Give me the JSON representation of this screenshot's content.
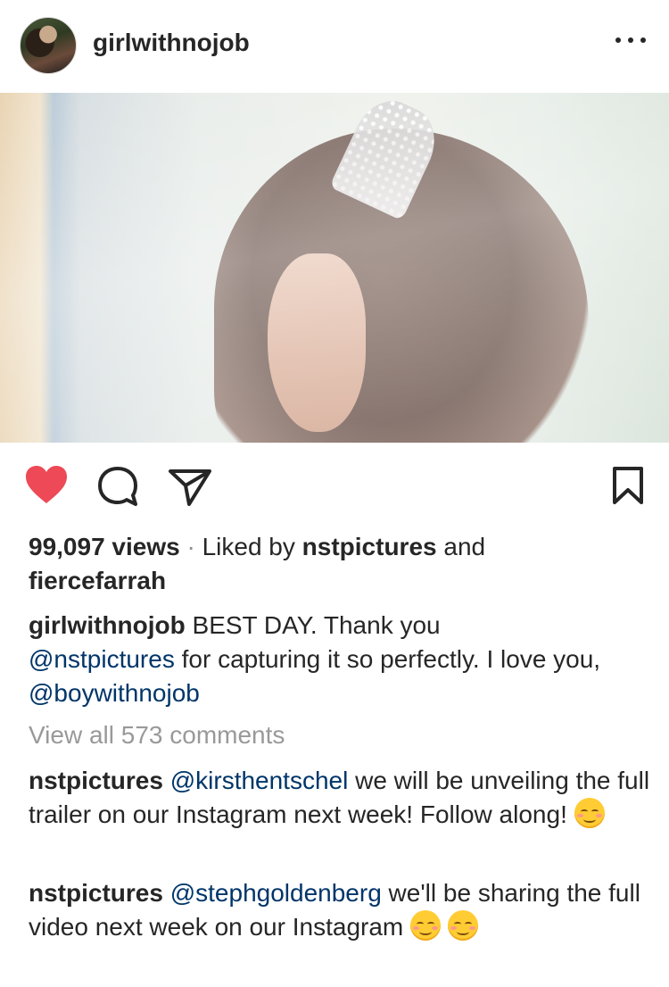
{
  "post": {
    "username": "girlwithnojob",
    "views_count": "99,097 views",
    "separator": "·",
    "liked_by_prefix": "Liked by",
    "liked_by_user1": "nstpictures",
    "liked_by_and": "and",
    "liked_by_user2": "fiercefarrah"
  },
  "caption": {
    "author": "girlwithnojob",
    "text_1": "BEST DAY. Thank you",
    "mention_1": "@nstpictures",
    "text_2": "for capturing it so perfectly. I love you,",
    "mention_2": "@boywithnojob"
  },
  "view_all_comments": "View all 573 comments",
  "comments": [
    {
      "author": "nstpictures",
      "mention": "@kirsthentschel",
      "text": "we will be unveiling the full trailer on our Instagram next week! Follow along!"
    },
    {
      "author": "nstpictures",
      "mention": "@stephgoldenberg",
      "text": "we'll be sharing the full video next week on our Instagram"
    }
  ],
  "icons": {
    "like": "heart-icon",
    "comment": "comment-icon",
    "share": "share-icon",
    "save": "bookmark-icon",
    "more": "more-options-icon"
  },
  "colors": {
    "like_active": "#ED4956",
    "mention": "#003569",
    "muted": "#999999",
    "text": "#262626"
  }
}
